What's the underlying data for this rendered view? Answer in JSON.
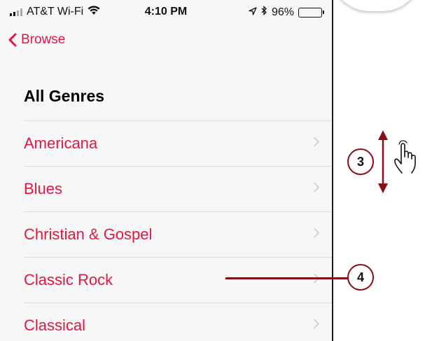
{
  "status_bar": {
    "carrier": "AT&T Wi-Fi",
    "time": "4:10 PM",
    "battery": "96%",
    "battery_level": 0.96
  },
  "nav": {
    "back_label": "Browse"
  },
  "section": {
    "title": "All Genres"
  },
  "genres": [
    {
      "label": "Americana"
    },
    {
      "label": "Blues"
    },
    {
      "label": "Christian & Gospel"
    },
    {
      "label": "Classic Rock"
    },
    {
      "label": "Classical"
    }
  ],
  "callouts": {
    "scroll_step": "3",
    "tap_step": "4"
  },
  "colors": {
    "accent": "#e11746",
    "callout": "#8b0e17"
  },
  "icons": [
    "wifi-icon",
    "location-arrow-icon",
    "bluetooth-icon",
    "battery-icon",
    "back-chevron-icon",
    "chevron-right-icon",
    "hand-pointer-icon"
  ]
}
